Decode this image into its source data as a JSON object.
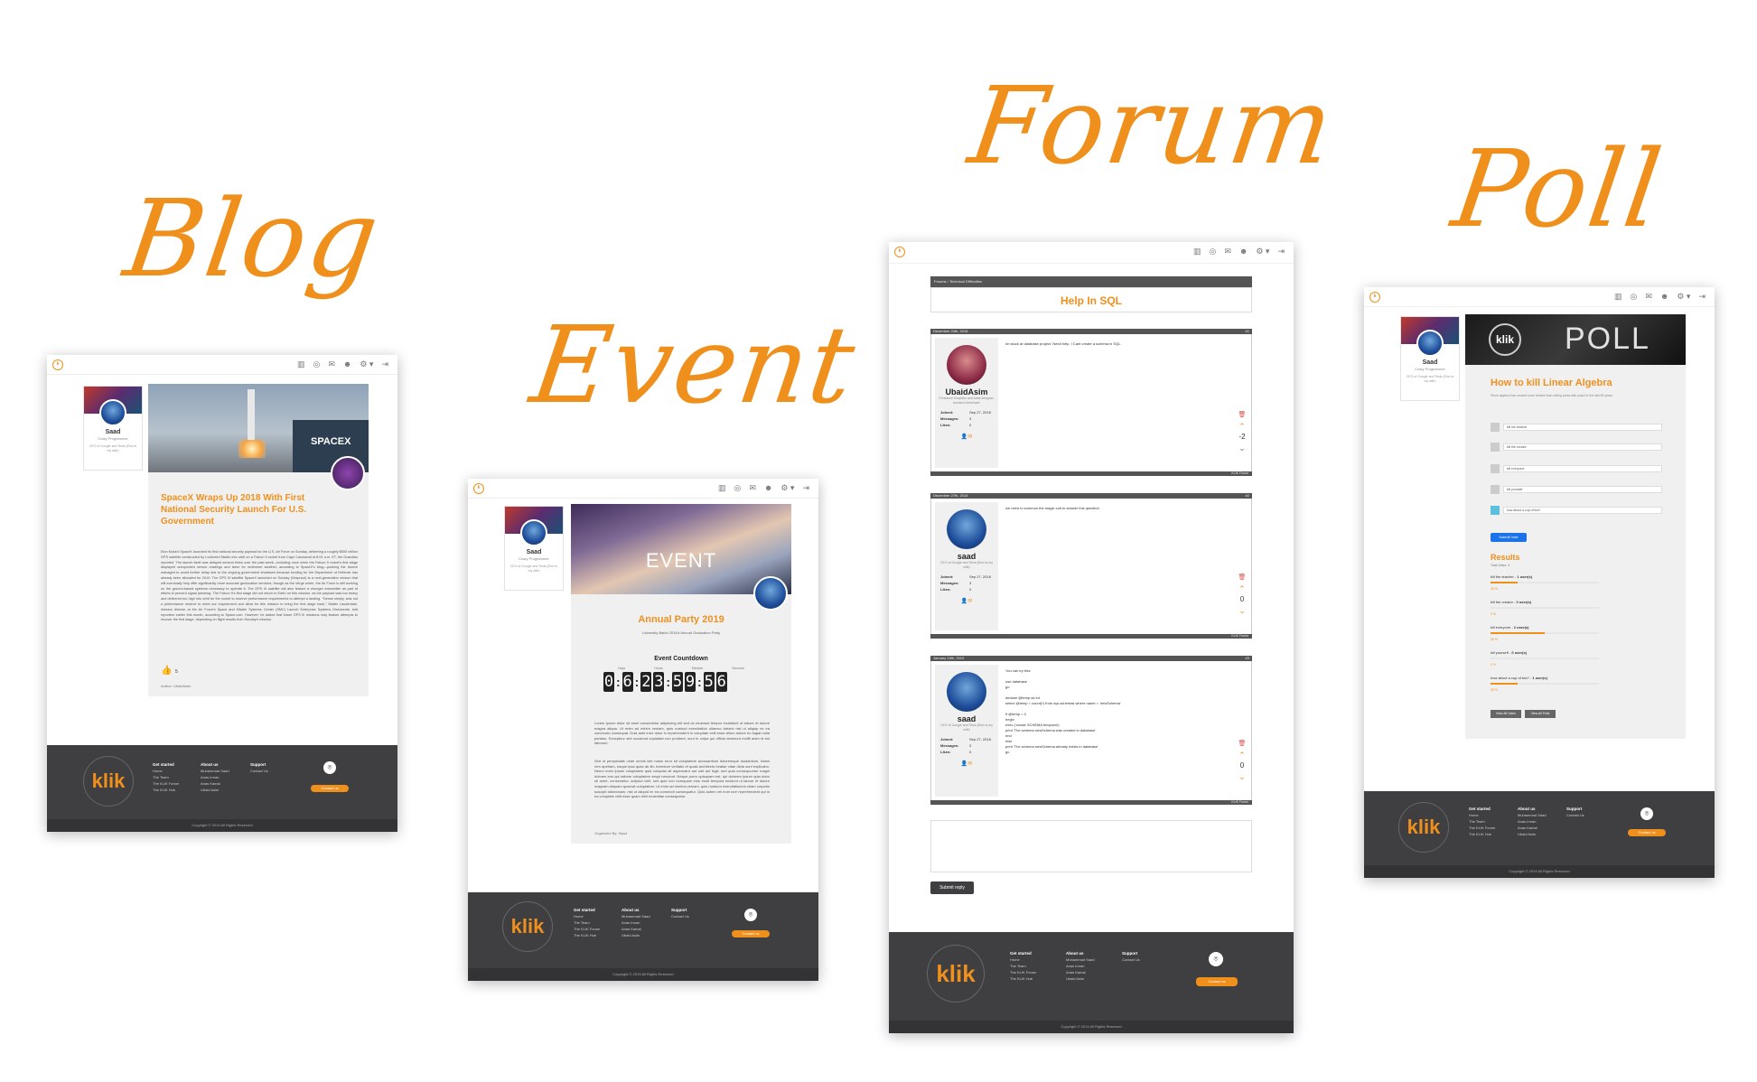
{
  "titles": {
    "blog": "Blog",
    "event": "Event",
    "forum": "Forum",
    "poll": "Poll"
  },
  "accent_color": "#f0901c",
  "nav_icons": [
    "chart-icon",
    "github-icon",
    "mail-icon",
    "users-icon",
    "gear-icon",
    "logout-icon"
  ],
  "nav_glyphs": [
    "▥",
    "◎",
    "✉",
    "☻",
    "⚙ ▾",
    "⇥"
  ],
  "profile": {
    "name": "Saad",
    "subtitle": "Crazy Programmer",
    "desc": "CEO of Google and Tesla (Elon is my wife)"
  },
  "footer": {
    "logo": "klik",
    "col1_title": "Get started",
    "col1_items": [
      "Home",
      "The Team",
      "The KLIK Forum",
      "The KLIK Hub"
    ],
    "col2_title": "About us",
    "col2_items": [
      "Muhammad Saad",
      "Anas Imran",
      "Anas Kamal",
      "Ubaid Asim"
    ],
    "col3_title": "Support",
    "col3_items": [
      "Contact Us"
    ],
    "contact_button": "Contact us",
    "copyright": "Copyright © 2019 All Rights Reserved"
  },
  "blog": {
    "headline": "SpaceX Wraps Up 2018 With First National Security Launch For U.S. Government",
    "body": "Elon Musk's SpaceX launched its first national security payload for the U.S. Air Force on Sunday, delivering a roughly $500 million GPS satellite constructed by Lockheed Martin into orbit on a Falcon 9 rocket from Cape Canaveral at 8:51 a.m. ET, the Guardian reported. The launch itself was delayed several times over the past week—including once when the Falcon 9 rocket's first stage displayed unexpected sensor readings and twice for inclement weather, according to SpaceX's blog—pushing the launch managed to avoid further delay due to the ongoing government shutdown because funding for the Department of Defense has already been allocated for 2019. The GPS III satellite SpaceX launched on Sunday (Vespucci) is a next-generation version that will eventually help offer significantly more accurate geolocation services, though as the Verge wrote, the Air Force is still working on the ground-based systems necessary to operate it. The GPS III satellite will also feature a stronger transmitter as part of efforts to prevent signal jamming. The Falcon 9's first stage did not return to Earth on this mission, as the payload was too heavy and delivered too high into orbit for the rocket to reserve performance requirements to attempt a landing. \"Dense simply, was not a performance reserve to meet our requirement and allow for this mission to bring the first stage back,\" Walter Lauderdale, mission director at the Air Force's Space and Missile Systems Center (SMC) Launch Enterprise Systems Directorate, told reporters earlier this month, according to Space.com. However, he added that future GPS III missions may feature attempts to recover the first stage, depending on flight results from Sunday's mission.",
    "likes": "5",
    "author": "Author: UbaidAsim"
  },
  "event": {
    "banner": "EVENT",
    "title": "Annual Party 2019",
    "subtitle": "University Batch 2016's Annual Graduation Party",
    "countdown_title": "Event Countdown",
    "countdown_labels": [
      "Days",
      "Hours",
      "Minutes",
      "Seconds"
    ],
    "countdown": [
      "0",
      "6",
      "2",
      "3",
      "5",
      "9",
      "5",
      "6"
    ],
    "para1": "Lorem ipsum dolor sit amet consectetur adipiscing elit sed do eiusmod tempor incididunt ut labore et dolore magna aliqua. Ut enim ad minim veniam, quis nostrud exercitation ullamco laboris nisi ut aliquip ex ea commodo consequat. Duis aute irure dolor in reprehenderit in voluptate velit esse cillum dolore eu fugiat nulla pariatur. Excepteur sint occaecat cupidatat non proident, sunt in culpa qui officia deserunt mollit anim id est laborum.",
    "para2": "Sed ut perspiciatis unde omnis iste natus error sit voluptatem accusantium doloremque laudantium, totam rem aperiam, eaque ipsa quae ab illo inventore veritatis et quasi architecto beatae vitae dicta sunt explicabo. Nemo enim ipsam voluptatem quia voluptas sit aspernatur aut odit aut fugit, sed quia consequuntur magni dolores eos qui ratione voluptatem sequi nesciunt. Neque porro quisquam est, qui dolorem ipsum quia dolor sit amet, consectetur, adipisci velit, sed quia non numquam eius modi tempora incidunt ut labore et dolore magnam aliquam quaerat voluptatem. Ut enim ad minima veniam, quis nostrum exercitationem ullam corporis suscipit laboriosam, nisi ut aliquid ex ea commodi consequatur. Quis autem vel eum iure reprehenderit qui in ea voluptate velit esse quam nihil molestiae consequatur.",
    "organizer": "Organized By: Saad"
  },
  "forum": {
    "breadcrumb": "Forums  ›  Technical Difficulties",
    "topic": "Help In SQL",
    "footer_label": "KLIK Forum",
    "submit": "Submit reply",
    "stat_labels": [
      "Joined:",
      "Messages:",
      "Likes:"
    ],
    "posts": [
      {
        "date": "December 24th, 2018",
        "num": "#1",
        "user": "UbaidAsim",
        "desc": "Freelance Graphics and Artist designer, backend developer",
        "joined": "Sep 27, 2018",
        "messages": "3",
        "likes": "0",
        "votes": "-2",
        "text": "Im stuck at database project. Need help. I Cant create a schema in SQL."
      },
      {
        "date": "December 27th, 2018",
        "num": "#2",
        "user": "saad",
        "desc": "CEO of Google and Tesla (Elon is my wife)",
        "joined": "Sep 27, 2018",
        "messages": "3",
        "likes": "0",
        "votes": "0",
        "text": "we need to summon the magic cult to answer this question"
      },
      {
        "date": "January 16th, 2019",
        "num": "#3",
        "user": "saad",
        "desc": "CEO of Google and Tesla (Elon is my wife)",
        "joined": "Sep 27, 2018",
        "messages": "3",
        "likes": "0",
        "votes": "0",
        "text": "You can try this:\n\nuse database\ngo\n\ndeclare @temp as int\nselect @temp = count(*) from sys.schemas where name = 'newSchema'\n\nif @temp = 0\nbegin\nexec ('create SCHEMA temporal')\nprint 'The schema newSchema was created in database'\nend\nelse\nprint 'The schema newSchema already exists in database'\ngo"
      }
    ]
  },
  "poll": {
    "banner_logo": "klik",
    "banner": "POLL",
    "question": "How to kill Linear Algebra",
    "subtitle": "Since algebra has caused more deaths than eating pizza with pepsi in the last 80 years",
    "options": [
      "kill the teacher",
      "kill the creator",
      "kill everyone",
      "kill yourself",
      "how about a cup of tea?"
    ],
    "submit": "Submit Vote",
    "results_title": "Results",
    "total_votes": "Total Votes: 4",
    "results": [
      {
        "label": "kill the teacher",
        "votes": "1 user(s)",
        "pct": 25
      },
      {
        "label": "kill the creator",
        "votes": "0 user(s)",
        "pct": 0
      },
      {
        "label": "kill everyone",
        "votes": "2 user(s)",
        "pct": 50
      },
      {
        "label": "kill yourself",
        "votes": "0 user(s)",
        "pct": 0
      },
      {
        "label": "how about a cup of tea?",
        "votes": "1 user(s)",
        "pct": 25
      }
    ],
    "pct_labels": [
      "25 %",
      "0 %",
      "50 %",
      "0 %",
      "25 %"
    ],
    "view_all_votes": "View All Votes",
    "view_all_polls": "View All Polls"
  }
}
